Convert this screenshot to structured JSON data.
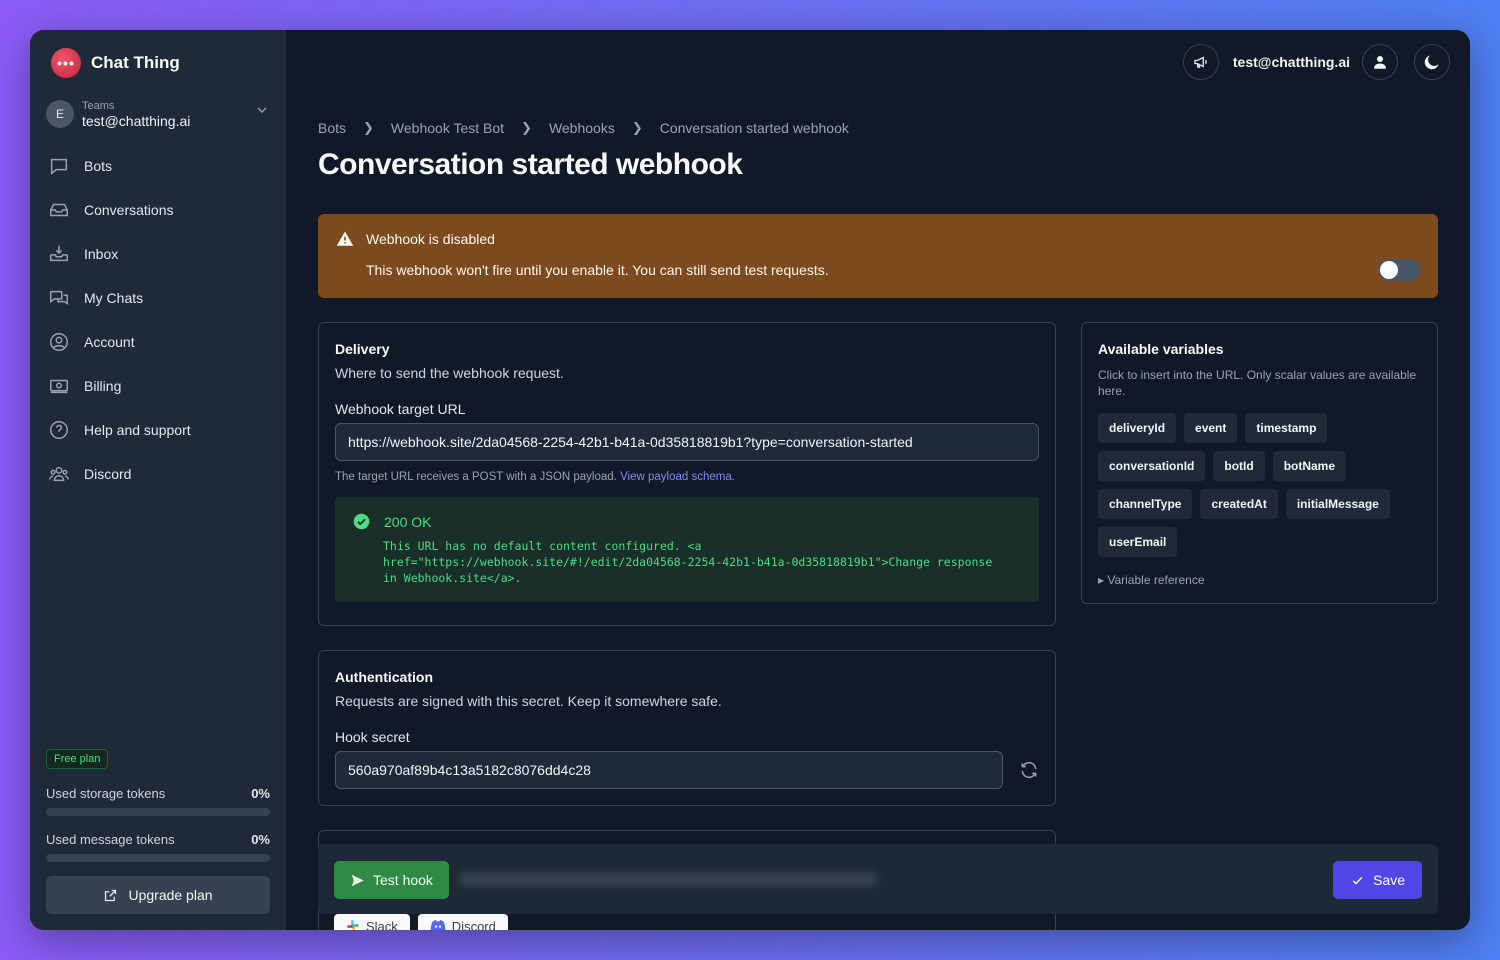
{
  "brand": {
    "name": "Chat Thing",
    "logo_glyph": "•••"
  },
  "team": {
    "avatar_letter": "E",
    "label": "Teams",
    "email": "test@chatthing.ai"
  },
  "nav": [
    {
      "label": "Bots",
      "icon": "chat-bubble-icon"
    },
    {
      "label": "Conversations",
      "icon": "inbox-stack-icon"
    },
    {
      "label": "Inbox",
      "icon": "inbox-download-icon"
    },
    {
      "label": "My Chats",
      "icon": "chat-bubbles-icon"
    },
    {
      "label": "Account",
      "icon": "user-circle-icon"
    },
    {
      "label": "Billing",
      "icon": "banknotes-icon"
    },
    {
      "label": "Help and support",
      "icon": "question-circle-icon"
    },
    {
      "label": "Discord",
      "icon": "user-group-icon"
    }
  ],
  "plan": {
    "badge": "Free plan"
  },
  "usage": {
    "storage": {
      "label": "Used storage tokens",
      "value": "0%",
      "fraction": 0
    },
    "message": {
      "label": "Used message tokens",
      "value": "0%",
      "fraction": 0
    }
  },
  "upgrade_label": "Upgrade plan",
  "topbar": {
    "email": "test@chatthing.ai"
  },
  "breadcrumb": [
    "Bots",
    "Webhook Test Bot",
    "Webhooks",
    "Conversation started webhook"
  ],
  "page_title": "Conversation started webhook",
  "alert": {
    "title": "Webhook is disabled",
    "text": "This webhook won't fire until you enable it. You can still send test requests.",
    "enabled": false
  },
  "delivery": {
    "title": "Delivery",
    "subtitle": "Where to send the webhook request.",
    "url_label": "Webhook target URL",
    "url_value": "https://webhook.site/2da04568-2254-42b1-b41a-0d35818819b1?type=conversation-started",
    "help_text": "The target URL receives a POST with a JSON payload.",
    "help_link": "View payload schema.",
    "response_status": "200 OK",
    "response_body": "This URL has no default content configured. <a\nhref=\"https://webhook.site/#!/edit/2da04568-2254-42b1-b41a-0d35818819b1\">Change response\nin Webhook.site</a>."
  },
  "variables": {
    "title": "Available variables",
    "subtitle": "Click to insert into the URL. Only scalar values are available here.",
    "items": [
      "deliveryId",
      "event",
      "timestamp",
      "conversationId",
      "botId",
      "botName",
      "channelType",
      "createdAt",
      "initialMessage",
      "userEmail"
    ],
    "reference": "▸ Variable reference"
  },
  "auth": {
    "title": "Authentication",
    "subtitle": "Requests are signed with this secret. Keep it somewhere safe.",
    "secret_label": "Hook secret",
    "secret_value": "560a970af89b4c13a5182c8076dd4c28"
  },
  "actions": {
    "test_label": "Test hook",
    "save_label": "Save"
  },
  "platforms": [
    "Slack",
    "Discord"
  ],
  "colors": {
    "accent": "#4f46e5",
    "success": "#2f8a45",
    "warning_bg": "#7c4a1f"
  }
}
